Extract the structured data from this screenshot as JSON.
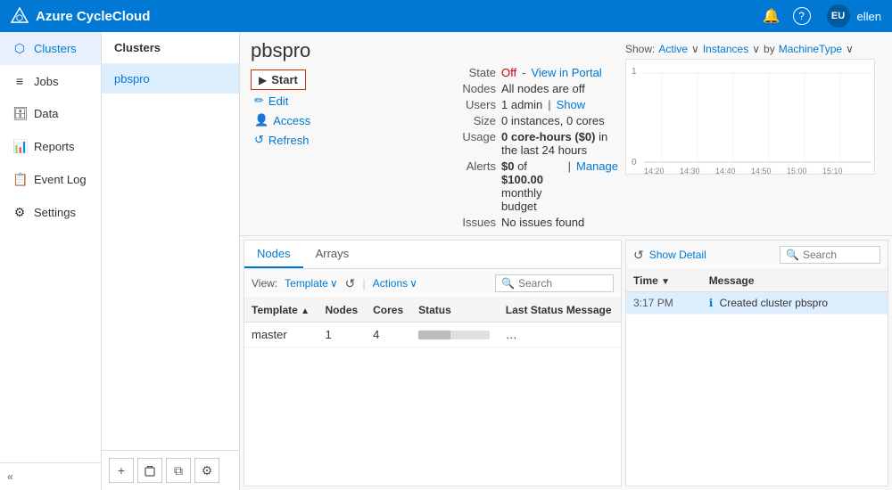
{
  "header": {
    "logo_text": "Azure CycleCloud",
    "notification_icon": "🔔",
    "help_icon": "?",
    "user_initials": "EU",
    "username": "ellen"
  },
  "sidebar": {
    "items": [
      {
        "id": "clusters",
        "label": "Clusters",
        "icon": "⬡",
        "active": true
      },
      {
        "id": "jobs",
        "label": "Jobs",
        "icon": "≡"
      },
      {
        "id": "data",
        "label": "Data",
        "icon": "🗄"
      },
      {
        "id": "reports",
        "label": "Reports",
        "icon": "📊"
      },
      {
        "id": "event-log",
        "label": "Event Log",
        "icon": "📋"
      },
      {
        "id": "settings",
        "label": "Settings",
        "icon": "⚙"
      }
    ],
    "collapse_icon": "«"
  },
  "cluster_panel": {
    "title": "Clusters",
    "items": [
      {
        "label": "pbspro",
        "active": true
      }
    ],
    "footer_buttons": [
      {
        "id": "add",
        "icon": "+"
      },
      {
        "id": "delete",
        "icon": "🗑"
      },
      {
        "id": "copy",
        "icon": "⧉"
      },
      {
        "id": "settings",
        "icon": "⚙"
      }
    ]
  },
  "cluster_detail": {
    "title": "pbspro",
    "actions": [
      {
        "id": "start",
        "label": "Start",
        "icon": "▶",
        "highlight": true
      },
      {
        "id": "edit",
        "label": "Edit",
        "icon": "✏"
      },
      {
        "id": "access",
        "label": "Access",
        "icon": "👤"
      },
      {
        "id": "refresh",
        "label": "Refresh",
        "icon": "↺"
      }
    ],
    "info": {
      "state_label": "State",
      "state_value": "Off",
      "state_link": "View in Portal",
      "nodes_label": "Nodes",
      "nodes_value": "All nodes are off",
      "users_label": "Users",
      "users_value": "1 admin",
      "users_link": "Show",
      "size_label": "Size",
      "size_value": "0 instances, 0 cores",
      "usage_label": "Usage",
      "usage_value": "0 core-hours ($0) in the last 24 hours",
      "alerts_label": "Alerts",
      "alerts_value": "$0 of $100.00 monthly budget",
      "alerts_link": "Manage",
      "issues_label": "Issues",
      "issues_value": "No issues found"
    },
    "chart": {
      "show_label": "Show:",
      "filter1": "Active",
      "filter2": "Instances",
      "by_label": "by",
      "filter3": "MachineType",
      "y_max": "1",
      "y_min": "0",
      "x_labels": [
        "14:20",
        "14:30",
        "14:40",
        "14:50",
        "15:00",
        "15:10"
      ]
    }
  },
  "nodes_panel": {
    "tabs": [
      {
        "id": "nodes",
        "label": "Nodes",
        "active": true
      },
      {
        "id": "arrays",
        "label": "Arrays"
      }
    ],
    "toolbar": {
      "view_label": "View:",
      "view_value": "Template",
      "actions_label": "Actions",
      "search_placeholder": "Search"
    },
    "table": {
      "columns": [
        {
          "id": "template",
          "label": "Template",
          "sort": "▲"
        },
        {
          "id": "nodes",
          "label": "Nodes"
        },
        {
          "id": "cores",
          "label": "Cores"
        },
        {
          "id": "status",
          "label": "Status"
        },
        {
          "id": "last_status",
          "label": "Last Status Message"
        }
      ],
      "rows": [
        {
          "template": "master",
          "nodes": "1",
          "cores": "4",
          "status_pct": 45,
          "last_status": "…"
        }
      ]
    }
  },
  "event_panel": {
    "show_detail_label": "Show Detail",
    "search_placeholder": "Search",
    "table": {
      "columns": [
        {
          "id": "time",
          "label": "Time",
          "sort": "▼"
        },
        {
          "id": "message",
          "label": "Message"
        }
      ],
      "rows": [
        {
          "time": "3:17 PM",
          "icon": "ℹ",
          "message": "Created cluster pbspro",
          "selected": true
        }
      ]
    }
  }
}
